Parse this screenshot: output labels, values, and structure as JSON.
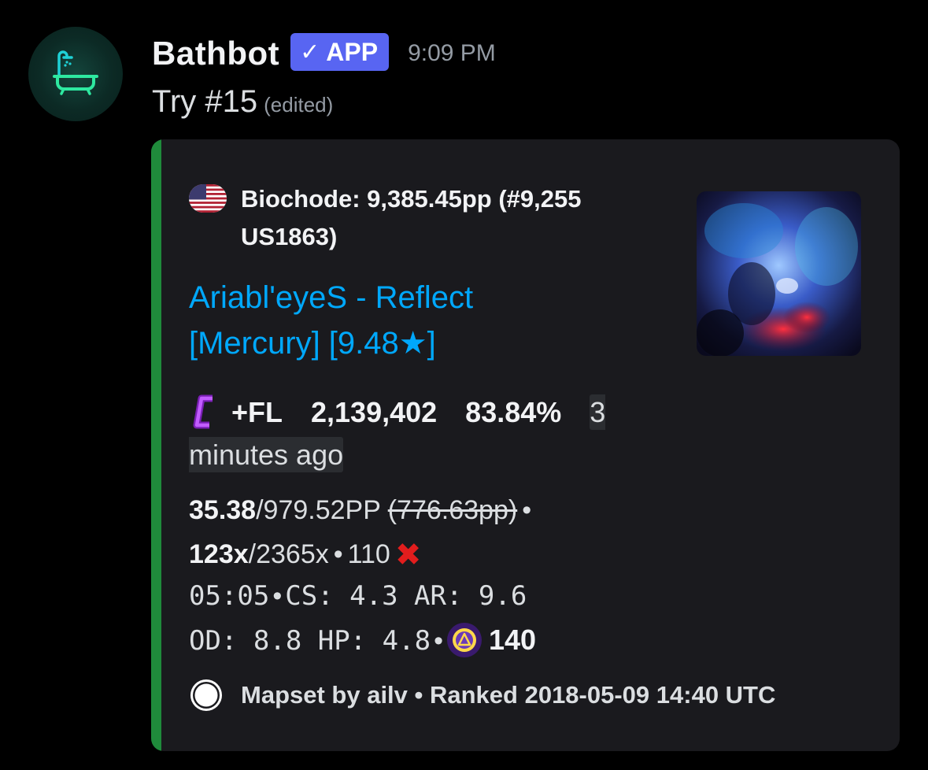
{
  "message": {
    "username": "Bathbot",
    "badge": {
      "check": "✓",
      "label": "APP"
    },
    "timestamp": "9:09 PM",
    "content": "Try #15",
    "edited": "(edited)",
    "avatar_icon": "bathtub-shower-icon"
  },
  "embed": {
    "accent_color": "#1f8b3b",
    "author": {
      "flag_icon": "us-flag-icon",
      "name": "Biochode: 9,385.45pp (#9,255 US1863)"
    },
    "title": "Ariabl'eyeS - Reflect [Mercury] [9.48★]",
    "title_color": "#00a8fc",
    "grade_icon": "grade-c-icon",
    "mods": "+FL",
    "score": "2,139,402",
    "accuracy": "83.84%",
    "time_ago": "3 minutes ago",
    "pp": "35.38",
    "max_pp": "/979.52PP",
    "fc_pp": "(776.63pp)",
    "separator": "•",
    "combo": "123x",
    "max_combo": "/2365x",
    "misses": "110",
    "miss_icon": "✖",
    "length": "05:05",
    "cs": "CS: 4.3",
    "ar": "AR: 9.6",
    "od": "OD: 8.8",
    "hp": "HP: 4.8",
    "mapper_icon": "mapper-badge-icon",
    "note_count": "140",
    "footer_icon": "osu-icon",
    "footer": "Mapset by ailv • Ranked 2018-05-09 14:40 UTC"
  }
}
